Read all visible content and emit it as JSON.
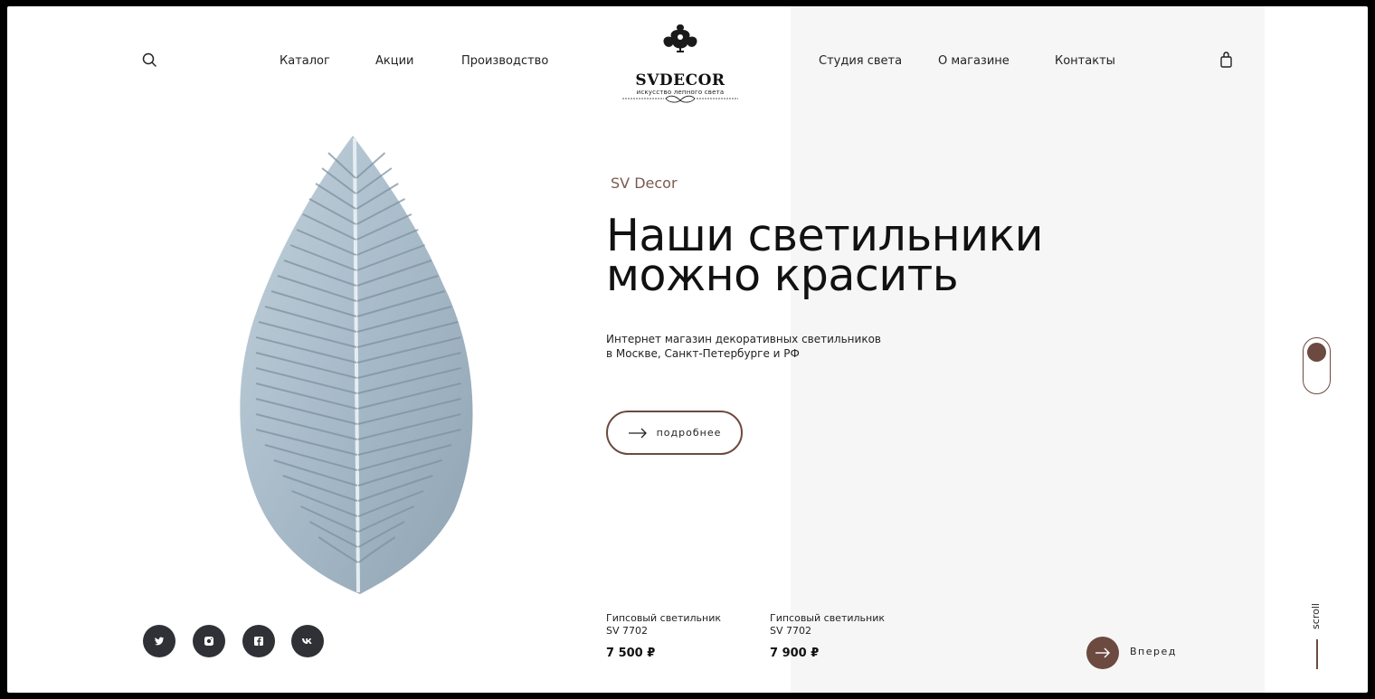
{
  "nav": {
    "left": [
      "Каталог",
      "Акции",
      "Производство"
    ],
    "right": [
      "Студия света",
      "О магазине",
      "Контакты"
    ]
  },
  "logo": {
    "name": "SVDECOR",
    "tagline": "искусство лепного света"
  },
  "hero": {
    "eyebrow": "SV Decor",
    "headline_line1": "Наши светильники",
    "headline_line2": "можно красить",
    "description_line1": "Интернет магазин декоративных светильников",
    "description_line2": "в Москве, Санкт-Петербурге и РФ",
    "button_label": "подробнее"
  },
  "products": [
    {
      "name": "Гипсовый светильник",
      "model": "SV 7702",
      "price": "7 500 ₽"
    },
    {
      "name": "Гипсовый светильник",
      "model": "SV 7702",
      "price": "7 900 ₽"
    }
  ],
  "socials": [
    "twitter-icon",
    "instagram-icon",
    "facebook-icon",
    "vk-icon"
  ],
  "next_label": "Вперед",
  "scroll_label": "scroll",
  "colors": {
    "accent": "#6c4a40",
    "panel": "#f6f6f6",
    "social_bg": "#2f3136",
    "leaf": "#a9bcca"
  }
}
